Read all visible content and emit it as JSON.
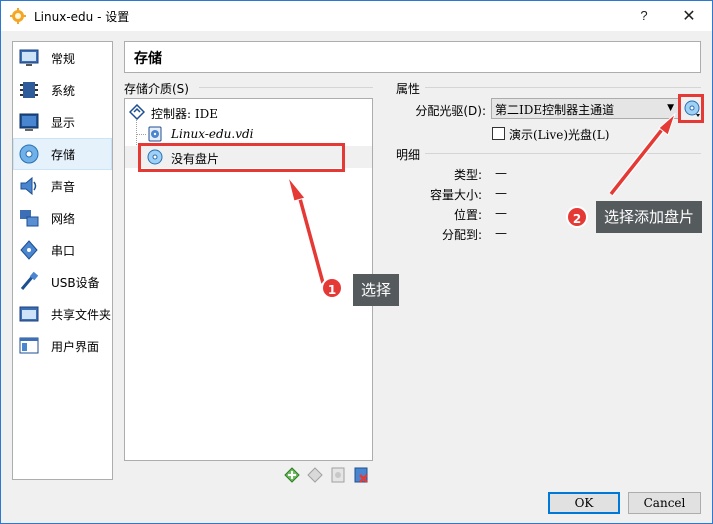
{
  "window": {
    "title": "Linux-edu - 设置",
    "help_glyph": "?",
    "close_glyph": "✕"
  },
  "sidebar": {
    "items": [
      {
        "label": "常规",
        "icon": "monitor-icon"
      },
      {
        "label": "系统",
        "icon": "chip-icon"
      },
      {
        "label": "显示",
        "icon": "display-icon"
      },
      {
        "label": "存储",
        "icon": "disk-icon",
        "active": true
      },
      {
        "label": "声音",
        "icon": "speaker-icon"
      },
      {
        "label": "网络",
        "icon": "network-icon"
      },
      {
        "label": "串口",
        "icon": "serial-icon"
      },
      {
        "label": "USB设备",
        "icon": "usb-icon"
      },
      {
        "label": "共享文件夹",
        "icon": "folder-icon"
      },
      {
        "label": "用户界面",
        "icon": "ui-icon"
      }
    ]
  },
  "page": {
    "title": "存储"
  },
  "storage": {
    "group_label": "存储介质(S)",
    "controller": "控制器: IDE",
    "items": [
      "Linux-edu.vdi",
      "没有盘片"
    ]
  },
  "attributes": {
    "group_label": "属性",
    "drive_label": "分配光驱(D):",
    "drive_value": "第二IDE控制器主通道",
    "live_cd_label": "演示(Live)光盘(L)",
    "live_cd_checked": false
  },
  "details": {
    "group_label": "明细",
    "rows": [
      {
        "label": "类型:",
        "value": "—"
      },
      {
        "label": "容量大小:",
        "value": "—"
      },
      {
        "label": "位置:",
        "value": "—"
      },
      {
        "label": "分配到:",
        "value": "—"
      }
    ]
  },
  "buttons": {
    "ok": "OK",
    "cancel": "Cancel"
  },
  "annotations": [
    {
      "number": "1",
      "text": "选择"
    },
    {
      "number": "2",
      "text": "选择添加盘片"
    }
  ],
  "colors": {
    "accent": "#0078d7",
    "annotation": "#e53935",
    "callout_bg": "#555a5d"
  }
}
